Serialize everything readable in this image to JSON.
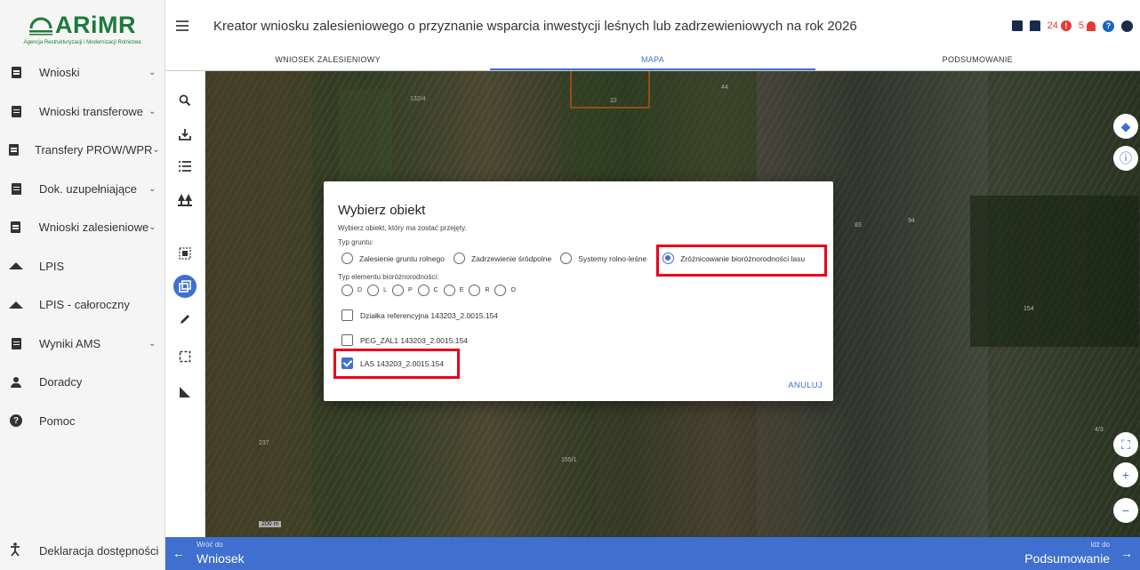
{
  "brand": {
    "logo_text": "ARiMR",
    "logo_sub": "Agencja Restrukturyzacji i Modernizacji Rolnictwa",
    "color": "#1e7a3c"
  },
  "sidebar": {
    "items": [
      {
        "label": "Wnioski",
        "icon": "document-icon",
        "has_chevron": true
      },
      {
        "label": "Wnioski transferowe",
        "icon": "document-icon",
        "has_chevron": true
      },
      {
        "label": "Transfery PROW/WPR",
        "icon": "document-icon",
        "has_chevron": true
      },
      {
        "label": "Dok. uzupełniające",
        "icon": "document-icon",
        "has_chevron": true
      },
      {
        "label": "Wnioski zalesieniowe",
        "icon": "document-icon",
        "has_chevron": true
      },
      {
        "label": "LPIS",
        "icon": "mountain-icon",
        "has_chevron": false
      },
      {
        "label": "LPIS - całoroczny",
        "icon": "mountain-icon",
        "has_chevron": false
      },
      {
        "label": "Wyniki AMS",
        "icon": "document-icon",
        "has_chevron": true
      },
      {
        "label": "Doradcy",
        "icon": "person-icon",
        "has_chevron": false
      },
      {
        "label": "Pomoc",
        "icon": "help-icon",
        "has_chevron": false
      }
    ],
    "bottom_item": {
      "label": "Deklaracja dostępności",
      "icon": "accessibility-icon"
    }
  },
  "header": {
    "title": "Kreator wniosku zalesieniowego o przyznanie wsparcia inwestycji leśnych lub zadrzewieniowych na rok 2026",
    "warnings_count": "24",
    "alerts_count": "5",
    "accent": "#3f6fcf",
    "alert_color": "#e53935"
  },
  "tabs": [
    {
      "label": "WNIOSEK ZALESIENIOWY",
      "active": false
    },
    {
      "label": "MAPA",
      "active": true
    },
    {
      "label": "PODSUMOWANIE",
      "active": false
    }
  ],
  "map": {
    "scale_label": "200 m"
  },
  "bottom_bar": {
    "back_small": "Wróć do",
    "back_big": "Wniosek",
    "next_small": "Idź do",
    "next_big": "Podsumowanie"
  },
  "dialog": {
    "title": "Wybierz obiekt",
    "instruction": "Wybierz obiekt, który ma zostać przejęty.",
    "typ_gruntu_label": "Typ gruntu:",
    "typ_gruntu_options": [
      {
        "label": "Zalesienie gruntu rolnego",
        "checked": false
      },
      {
        "label": "Zadrzewienie śródpolne",
        "checked": false
      },
      {
        "label": "Systemy rolno-leśne",
        "checked": false
      },
      {
        "label": "Zróżnicowanie bioróżnorodności lasu",
        "checked": true
      }
    ],
    "typ_elementu_label": "Typ elementu bioróżnorodności:",
    "typ_elementu_options": [
      "D",
      "L",
      "P",
      "C",
      "E",
      "R",
      "O"
    ],
    "checkboxes": [
      {
        "label": "Działka referencyjna 143203_2.0015.154",
        "checked": false
      },
      {
        "label": "PEG_ZAL1 143203_2.0015.154",
        "checked": false
      },
      {
        "label": "LAS 143203_2.0015.154",
        "checked": true
      }
    ],
    "cancel_label": "ANULUJ"
  }
}
